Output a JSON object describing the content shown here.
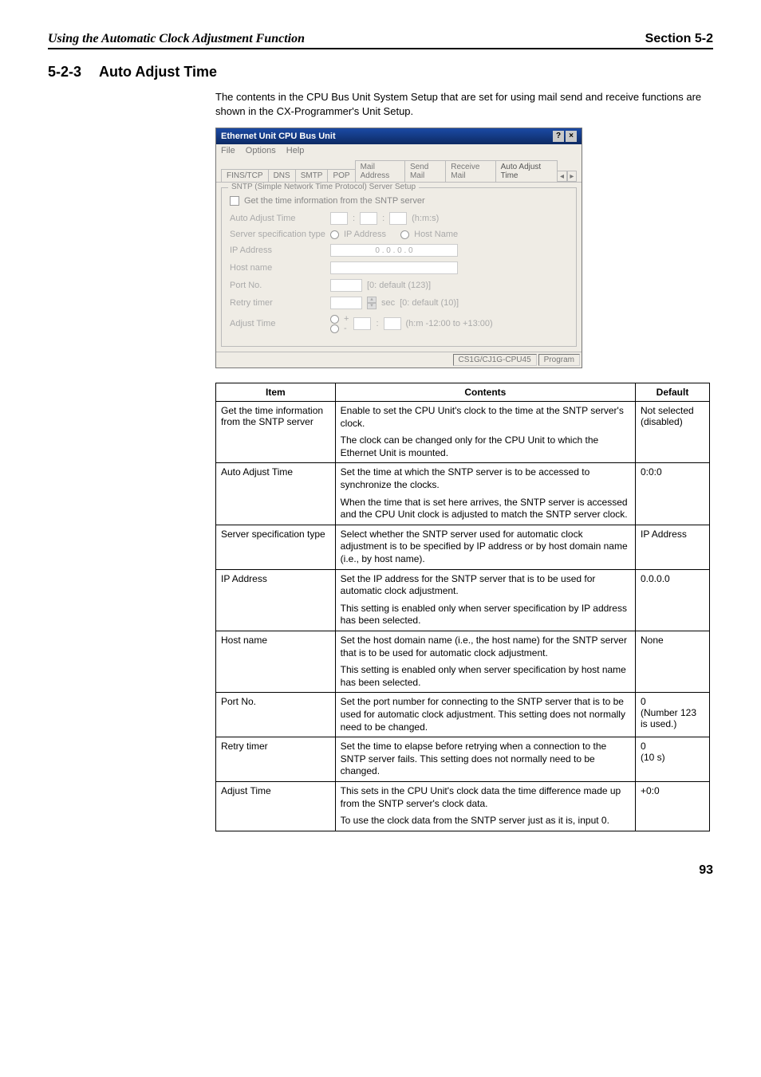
{
  "page": {
    "header_left": "Using the Automatic Clock Adjustment Function",
    "header_right": "Section 5-2",
    "heading_number": "5-2-3",
    "heading_title": "Auto Adjust Time",
    "intro": "The contents in the CPU Bus Unit System Setup that are set for using mail send and receive functions are shown in the CX-Programmer's Unit Setup.",
    "page_number": "93"
  },
  "window": {
    "title": "Ethernet Unit CPU Bus Unit",
    "menu": [
      "File",
      "Options",
      "Help"
    ],
    "tabs": [
      "FINS/TCP",
      "DNS",
      "SMTP",
      "POP",
      "Mail Address",
      "Send Mail",
      "Receive Mail",
      "Auto Adjust Time"
    ],
    "group_title": "SNTP (Simple Network Time Protocol) Server Setup",
    "checkbox_label": "Get the time information from the SNTP server",
    "rows": {
      "auto_adjust_time": {
        "label": "Auto Adjust Time",
        "unit": "(h:m:s)"
      },
      "server_spec": {
        "label": "Server specification type",
        "opt1": "IP Address",
        "opt2": "Host Name"
      },
      "ip_address": {
        "label": "IP Address",
        "placeholder": "0   .   0   .   0   .   0"
      },
      "host_name": {
        "label": "Host name"
      },
      "port_no": {
        "label": "Port No.",
        "hint": "[0: default (123)]"
      },
      "retry_timer": {
        "label": "Retry timer",
        "unit": "sec",
        "hint": "[0: default (10)]"
      },
      "adjust_time": {
        "label": "Adjust Time",
        "hint": "(h:m  -12:00 to +13:00)"
      }
    },
    "status": [
      "CS1G/CJ1G-CPU45",
      "Program"
    ]
  },
  "table": {
    "headers": [
      "Item",
      "Contents",
      "Default"
    ],
    "rows": [
      {
        "item": "Get the time information from the SNTP server",
        "contents": [
          "Enable to set the CPU Unit's clock to the time at the SNTP server's clock.",
          "The clock can be changed only for the CPU Unit to which the Ethernet Unit is mounted."
        ],
        "default": "Not selected (disabled)"
      },
      {
        "item": "Auto Adjust Time",
        "contents": [
          "Set the time at which the SNTP server is to be accessed to synchronize the clocks.",
          "When the time that is set here arrives, the SNTP server is accessed and the CPU Unit clock is adjusted to match the SNTP server clock."
        ],
        "default": "0:0:0"
      },
      {
        "item": "Server specification type",
        "contents": [
          "Select whether the SNTP server used for automatic clock adjustment is to be specified by IP address or by host domain name (i.e., by host name)."
        ],
        "default": "IP Address"
      },
      {
        "item": "IP Address",
        "contents": [
          "Set the IP address for the SNTP server that is to be used for automatic clock adjustment.",
          "This setting is enabled only when server specification by IP address has been selected."
        ],
        "default": "0.0.0.0"
      },
      {
        "item": "Host name",
        "contents": [
          "Set the host domain name (i.e., the host name) for the SNTP server that is to be used for automatic clock adjustment.",
          "This setting is enabled only when server specification by host name has been selected."
        ],
        "default": "None"
      },
      {
        "item": "Port No.",
        "contents": [
          "Set the port number for connecting to the SNTP server that is to be used for automatic clock adjustment. This setting does not normally need to be changed."
        ],
        "default": "0\n(Number 123 is used.)"
      },
      {
        "item": "Retry timer",
        "contents": [
          "Set the time to elapse before retrying when a connection to the SNTP server fails. This setting does not normally need to be changed."
        ],
        "default": "0\n(10 s)"
      },
      {
        "item": "Adjust Time",
        "contents": [
          "This sets in the CPU Unit's clock data the time difference made up from the SNTP server's clock data.",
          "To use the clock data from the SNTP server just as it is, input 0."
        ],
        "default": "+0:0"
      }
    ]
  }
}
